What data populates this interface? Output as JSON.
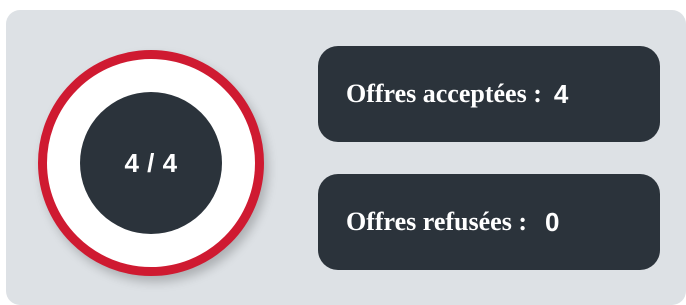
{
  "progress": {
    "text": "4 / 4",
    "fraction": 1.0
  },
  "accepted": {
    "label": "Offres acceptées :",
    "value": "4"
  },
  "refused": {
    "label": "Offres refusées :",
    "value": "0"
  },
  "colors": {
    "panel": "#dde1e5",
    "dark": "#2b333b",
    "ring": "#cf1a31"
  }
}
